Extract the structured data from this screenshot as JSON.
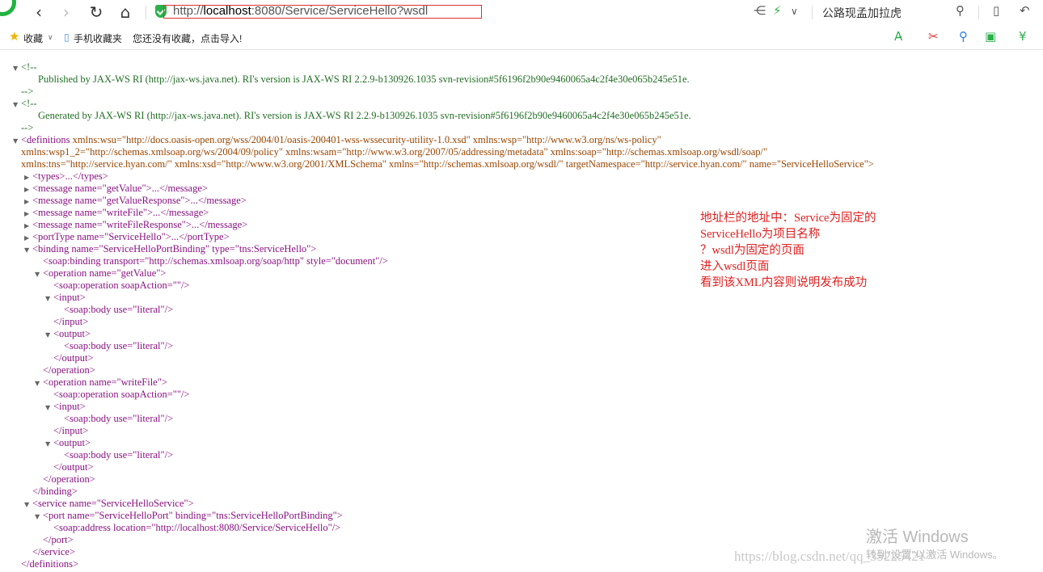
{
  "browser": {
    "url_prefix": "http://",
    "url_host": "localhost",
    "url_rest": ":8080/Service/ServiceHello?wsdl",
    "search_hint": "公路现孟加拉虎"
  },
  "bookmarks": {
    "favorites": "收藏",
    "mobile": "手机收藏夹",
    "import_prompt": "您还没有收藏，点击导入!"
  },
  "xml": {
    "comment_open": "<!--",
    "comment_close": "-->",
    "comment1": "Published by JAX-WS RI (http://jax-ws.java.net). RI's version is JAX-WS RI 2.2.9-b130926.1035 svn-revision#5f6196f2b90e9460065a4c2f4e30e065b245e51e.",
    "comment2": "Generated by JAX-WS RI (http://jax-ws.java.net). RI's version is JAX-WS RI 2.2.9-b130926.1035 svn-revision#5f6196f2b90e9460065a4c2f4e30e065b245e51e.",
    "definitions_open": "<definitions",
    "defs_line1_attrs": " xmlns:wsu=\"http://docs.oasis-open.org/wss/2004/01/oasis-200401-wss-wssecurity-utility-1.0.xsd\" xmlns:wsp=\"http://www.w3.org/ns/ws-policy\"",
    "defs_line2": "xmlns:wsp1_2=\"http://schemas.xmlsoap.org/ws/2004/09/policy\" xmlns:wsam=\"http://www.w3.org/2007/05/addressing/metadata\" xmlns:soap=\"http://schemas.xmlsoap.org/wsdl/soap/\"",
    "defs_line3": "xmlns:tns=\"http://service.hyan.com/\" xmlns:xsd=\"http://www.w3.org/2001/XMLSchema\" xmlns=\"http://schemas.xmlsoap.org/wsdl/\" targetNamespace=\"http://service.hyan.com/\" name=\"ServiceHelloService\">",
    "types": "<types>...</types>",
    "msg1": "<message name=\"getValue\">...</message>",
    "msg2": "<message name=\"getValueResponse\">...</message>",
    "msg3": "<message name=\"writeFile\">...</message>",
    "msg4": "<message name=\"writeFileResponse\">...</message>",
    "porttype": "<portType name=\"ServiceHello\">...</portType>",
    "binding_open": "<binding name=\"ServiceHelloPortBinding\" type=\"tns:ServiceHello\">",
    "soap_binding": "<soap:binding transport=\"http://schemas.xmlsoap.org/soap/http\" style=\"document\"/>",
    "op1_open": "<operation name=\"getValue\">",
    "soap_op": "<soap:operation soapAction=\"\"/>",
    "input_open": "<input>",
    "soap_body": "<soap:body use=\"literal\"/>",
    "input_close": "</input>",
    "output_open": "<output>",
    "output_close": "</output>",
    "op_close": "</operation>",
    "op2_open": "<operation name=\"writeFile\">",
    "binding_close": "</binding>",
    "service_open": "<service name=\"ServiceHelloService\">",
    "port_open": "<port name=\"ServiceHelloPort\" binding=\"tns:ServiceHelloPortBinding\">",
    "soap_address": "<soap:address location=\"http://localhost:8080/Service/ServiceHello\"/>",
    "port_close": "</port>",
    "service_close": "</service>",
    "definitions_close": "</definitions>"
  },
  "annotation": [
    "地址栏的地址中：Service为固定的",
    "ServiceHello为项目名称",
    "？wsdl为固定的页面",
    "进入wsdl页面",
    "看到该XML内容则说明发布成功"
  ],
  "overlay": {
    "activate_title": "激活 Windows",
    "activate_sub": "转到\"设置\"以激活 Windows。",
    "watermark": "https://blog.csdn.net/qq_39225421"
  }
}
